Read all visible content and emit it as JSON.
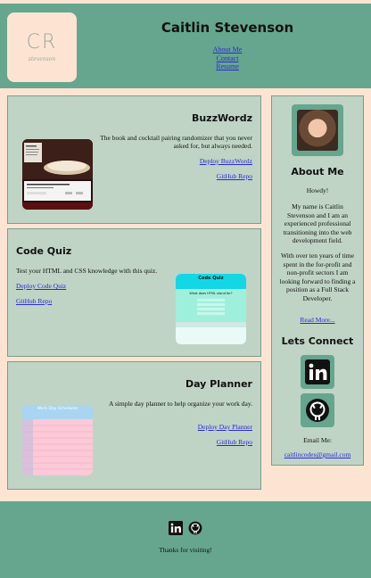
{
  "header": {
    "logo_monogram": "CR",
    "logo_script": "stevenson",
    "title": "Caitlin Stevenson",
    "nav": [
      "About Me",
      "Contact",
      "Resume"
    ]
  },
  "projects": [
    {
      "title": "BuzzWordz",
      "description": "The book and cocktail pairing randomizer that you never asked for, but always needed.",
      "deploy_label": "Deploy BuzzWordz",
      "repo_label": "GitHub Repo"
    },
    {
      "title": "Code Quiz",
      "description": "Test your HTML and CSS knowledge with this quiz.",
      "deploy_label": "Deploy Code Quiz",
      "repo_label": "GitHub Repo",
      "thumb_title": "Code Quiz",
      "thumb_question": "What does HTML stand for?"
    },
    {
      "title": "Day Planner",
      "description": "A simple day planner to help organize your work day.",
      "deploy_label": "Deploy Day Planner",
      "repo_label": "GitHub Repo",
      "thumb_title": "Work Day Scheduler"
    }
  ],
  "about": {
    "heading": "About Me",
    "greeting": "Howdy!",
    "para1": "My name is Caitlin Stevenson and I am an experienced professional transitioning into the web development field.",
    "para2": "With over ten years of time spent in the for-profit and non-profit sectors I am looking forward to finding a position as a Full Stack Developer.",
    "read_more": "Read More..."
  },
  "connect": {
    "heading": "Lets Connect",
    "email_label": "Email Me:",
    "email": "caitlincodes@gmail.com",
    "icons": [
      "linkedin-icon",
      "github-icon"
    ]
  },
  "footer": {
    "thanks": "Thanks for visiting!"
  },
  "colors": {
    "page_bg": "#fde4d2",
    "header_green": "#66a68e",
    "card_bg": "#bfd4c5",
    "link": "#2b2bd6"
  }
}
